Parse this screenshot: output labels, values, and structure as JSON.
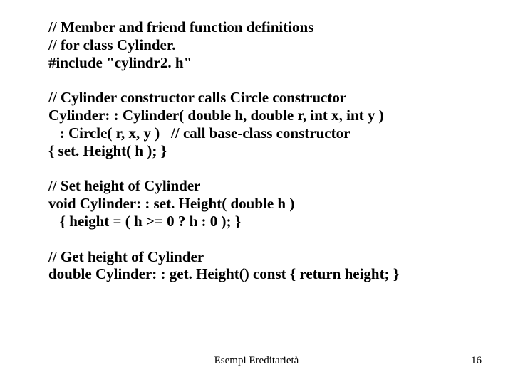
{
  "code": {
    "l1": "// Member and friend function definitions",
    "l2": "// for class Cylinder.",
    "l3": "#include \"cylindr2. h\"",
    "l4": "// Cylinder constructor calls Circle constructor",
    "l5": "Cylinder: : Cylinder( double h, double r, int x, int y )",
    "l6": "   : Circle( r, x, y )   // call base-class constructor",
    "l7": "{ set. Height( h ); }",
    "l8": "// Set height of Cylinder",
    "l9": "void Cylinder: : set. Height( double h )",
    "l10": "   { height = ( h >= 0 ? h : 0 ); }",
    "l11": "// Get height of Cylinder",
    "l12": "double Cylinder: : get. Height() const { return height; }"
  },
  "footer": {
    "center": "Esempi Ereditarietà",
    "page": "16"
  }
}
